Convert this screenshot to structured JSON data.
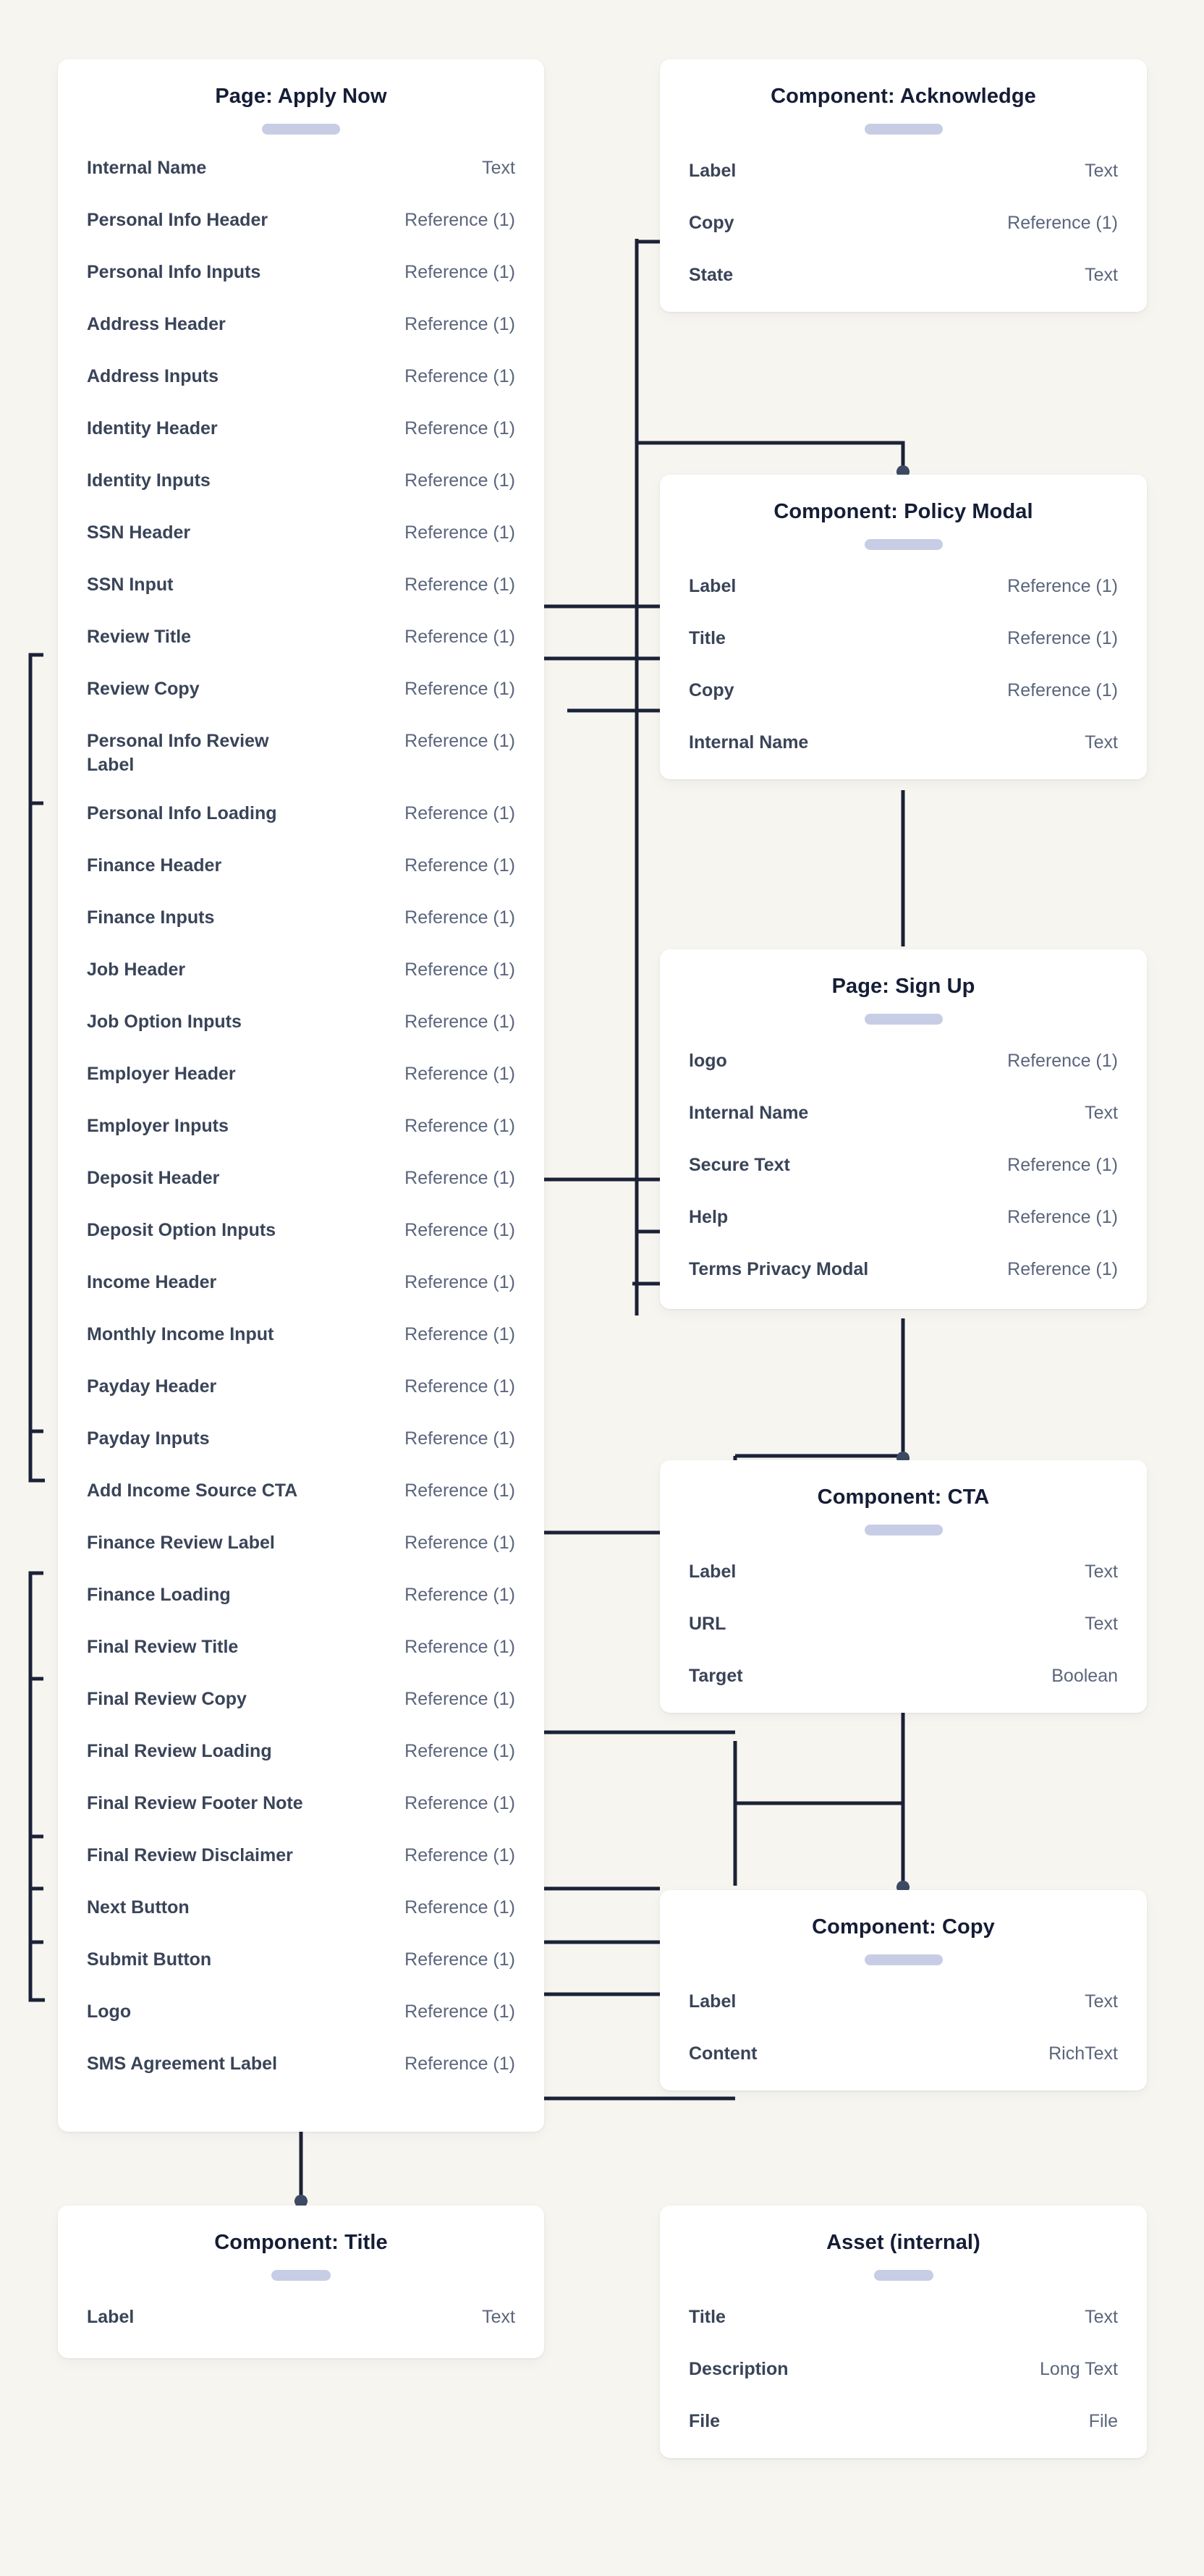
{
  "canvas": {
    "background": "#f7f5f0",
    "line_color": "#1b2237",
    "pill_color": "#c7cde4",
    "label_color": "#3a4458",
    "type_color": "#5b667c",
    "title_color": "#151d36"
  },
  "types": {
    "text": "Text",
    "reference_1": "Reference (1)",
    "boolean": "Boolean",
    "richtext": "RichText",
    "longtext": "Long Text",
    "file": "File"
  },
  "cards": [
    {
      "id": "page-apply-now",
      "title": "Page: Apply Now",
      "fields": [
        {
          "name": "Internal Name",
          "type": "Text"
        },
        {
          "name": "Personal Info Header",
          "type": "Reference (1)"
        },
        {
          "name": "Personal Info Inputs",
          "type": "Reference (1)"
        },
        {
          "name": "Address Header",
          "type": "Reference (1)"
        },
        {
          "name": "Address Inputs",
          "type": "Reference (1)"
        },
        {
          "name": "Identity Header",
          "type": "Reference (1)"
        },
        {
          "name": "Identity Inputs",
          "type": "Reference (1)"
        },
        {
          "name": "SSN Header",
          "type": "Reference (1)"
        },
        {
          "name": "SSN Input",
          "type": "Reference (1)"
        },
        {
          "name": "Review Title",
          "type": "Reference (1)"
        },
        {
          "name": "Review Copy",
          "type": "Reference (1)"
        },
        {
          "name": "Personal Info Review Label",
          "type": "Reference (1)"
        },
        {
          "name": "Personal Info Loading",
          "type": "Reference (1)"
        },
        {
          "name": "Finance Header",
          "type": "Reference (1)"
        },
        {
          "name": "Finance Inputs",
          "type": "Reference (1)"
        },
        {
          "name": "Job Header",
          "type": "Reference (1)"
        },
        {
          "name": "Job Option Inputs",
          "type": "Reference (1)"
        },
        {
          "name": "Employer Header",
          "type": "Reference (1)"
        },
        {
          "name": "Employer Inputs",
          "type": "Reference (1)"
        },
        {
          "name": "Deposit Header",
          "type": "Reference (1)"
        },
        {
          "name": "Deposit Option Inputs",
          "type": "Reference (1)"
        },
        {
          "name": "Income Header",
          "type": "Reference (1)"
        },
        {
          "name": "Monthly Income Input",
          "type": "Reference (1)"
        },
        {
          "name": "Payday Header",
          "type": "Reference (1)"
        },
        {
          "name": "Payday Inputs",
          "type": "Reference (1)"
        },
        {
          "name": "Add Income Source CTA",
          "type": "Reference (1)"
        },
        {
          "name": "Finance Review Label",
          "type": "Reference (1)"
        },
        {
          "name": "Finance Loading",
          "type": "Reference (1)"
        },
        {
          "name": "Final Review Title",
          "type": "Reference (1)"
        },
        {
          "name": "Final Review Copy",
          "type": "Reference (1)"
        },
        {
          "name": "Final Review Loading",
          "type": "Reference (1)"
        },
        {
          "name": "Final Review Footer Note",
          "type": "Reference (1)"
        },
        {
          "name": "Final Review Disclaimer",
          "type": "Reference (1)"
        },
        {
          "name": "Next Button",
          "type": "Reference (1)"
        },
        {
          "name": "Submit Button",
          "type": "Reference (1)"
        },
        {
          "name": "Logo",
          "type": "Reference (1)"
        },
        {
          "name": "SMS Agreement Label",
          "type": "Reference (1)"
        }
      ]
    },
    {
      "id": "component-acknowledge",
      "title": "Component: Acknowledge",
      "fields": [
        {
          "name": "Label",
          "type": "Text"
        },
        {
          "name": "Copy",
          "type": "Reference (1)"
        },
        {
          "name": "State",
          "type": "Text"
        }
      ]
    },
    {
      "id": "component-policy-modal",
      "title": "Component: Policy Modal",
      "fields": [
        {
          "name": "Label",
          "type": "Reference (1)"
        },
        {
          "name": "Title",
          "type": "Reference (1)"
        },
        {
          "name": "Copy",
          "type": "Reference (1)"
        },
        {
          "name": "Internal Name",
          "type": "Text"
        }
      ]
    },
    {
      "id": "page-sign-up",
      "title": "Page: Sign Up",
      "fields": [
        {
          "name": "logo",
          "type": "Reference (1)"
        },
        {
          "name": "Internal Name",
          "type": "Text"
        },
        {
          "name": "Secure Text",
          "type": "Reference (1)"
        },
        {
          "name": "Help",
          "type": "Reference (1)"
        },
        {
          "name": "Terms Privacy Modal",
          "type": "Reference (1)"
        }
      ]
    },
    {
      "id": "component-cta",
      "title": "Component: CTA",
      "fields": [
        {
          "name": "Label",
          "type": "Text"
        },
        {
          "name": "URL",
          "type": "Text"
        },
        {
          "name": "Target",
          "type": "Boolean"
        }
      ]
    },
    {
      "id": "component-copy",
      "title": "Component: Copy",
      "fields": [
        {
          "name": "Label",
          "type": "Text"
        },
        {
          "name": "Content",
          "type": "RichText"
        }
      ]
    },
    {
      "id": "component-title",
      "title": "Component: Title",
      "fields": [
        {
          "name": "Label",
          "type": "Text"
        }
      ]
    },
    {
      "id": "asset-internal",
      "title": "Asset (internal)",
      "fields": [
        {
          "name": "Title",
          "type": "Text"
        },
        {
          "name": "Description",
          "type": "Long Text"
        },
        {
          "name": "File",
          "type": "File"
        }
      ]
    }
  ]
}
